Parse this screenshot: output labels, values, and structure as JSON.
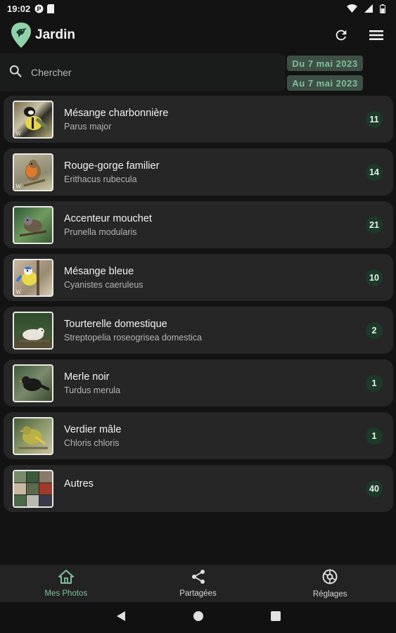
{
  "status_bar": {
    "time": "19:02"
  },
  "app_bar": {
    "title": "Jardin",
    "refresh_icon": "refresh-icon",
    "menu_icon": "menu-icon"
  },
  "search": {
    "placeholder": "Chercher",
    "date_from": "Du 7 mai 2023",
    "date_to": "Au 7 mai 2023"
  },
  "birds": [
    {
      "common_name": "Mésange charbonnière",
      "scientific_name": "Parus major",
      "count": "11"
    },
    {
      "common_name": "Rouge-gorge familier",
      "scientific_name": "Erithacus rubecula",
      "count": "14"
    },
    {
      "common_name": "Accenteur mouchet",
      "scientific_name": "Prunella modularis",
      "count": "21"
    },
    {
      "common_name": "Mésange bleue",
      "scientific_name": "Cyanistes caeruleus",
      "count": "10"
    },
    {
      "common_name": "Tourterelle domestique",
      "scientific_name": "Streptopelia roseogrisea domestica",
      "count": "2"
    },
    {
      "common_name": "Merle noir",
      "scientific_name": "Turdus merula",
      "count": "1"
    },
    {
      "common_name": "Verdier mâle",
      "scientific_name": "Chloris chloris",
      "count": "1"
    },
    {
      "common_name": "Autres",
      "scientific_name": "",
      "count": "40"
    }
  ],
  "bottom_nav": [
    {
      "label": "Mes Photos",
      "icon": "home-icon",
      "active": true
    },
    {
      "label": "Partagées",
      "icon": "share-icon",
      "active": false
    },
    {
      "label": "Réglages",
      "icon": "settings-icon",
      "active": false
    }
  ],
  "colors": {
    "background": "#131313",
    "card": "#262626",
    "accent": "#7fbf9b",
    "badge": "#1d3a29"
  }
}
